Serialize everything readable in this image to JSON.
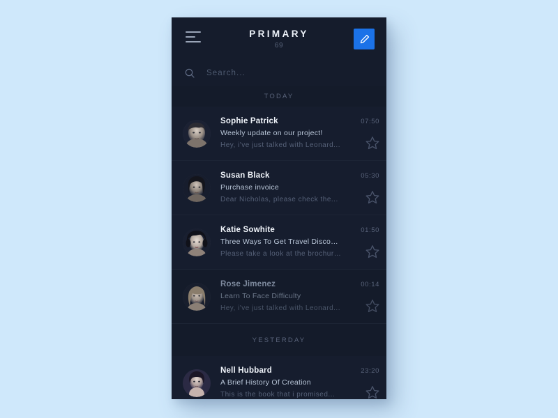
{
  "theme": {
    "page_background": "#cfe8fb",
    "app_background": "#161d2e",
    "header_background": "#151c2c",
    "accent": "#1b72e8",
    "divider": "#1d2536",
    "muted_text": "#59637a"
  },
  "header": {
    "menu_icon": "hamburger-icon",
    "title": "PRIMARY",
    "count": "69",
    "compose_icon": "pencil-icon"
  },
  "search": {
    "icon": "search-icon",
    "value": "",
    "placeholder": "Search..."
  },
  "sections": [
    {
      "label": "TODAY",
      "messages": [
        {
          "sender": "Sophie Patrick",
          "subject": "Weekly update on our project!",
          "preview": "Hey, i've just talked with Leonard...",
          "time": "07:50",
          "read": false,
          "starred": false,
          "star_icon": "star-outline-icon",
          "avatar": "avatar-sophie-patrick"
        },
        {
          "sender": "Susan Black",
          "subject": "Purchase invoice",
          "preview": "Dear Nicholas, please check the...",
          "time": "05:30",
          "read": false,
          "starred": false,
          "star_icon": "star-outline-icon",
          "avatar": "avatar-susan-black"
        },
        {
          "sender": "Katie Sowhite",
          "subject": "Three Ways To Get Travel Discounts",
          "preview": "Please take a look at the brochure...",
          "time": "01:50",
          "read": false,
          "starred": false,
          "star_icon": "star-outline-icon",
          "avatar": "avatar-katie-sowhite"
        },
        {
          "sender": "Rose Jimenez",
          "subject": "Learn To Face Difficulty",
          "preview": "Hey, i've just talked with Leonard...",
          "time": "00:14",
          "read": true,
          "starred": false,
          "star_icon": "star-outline-icon",
          "avatar": "avatar-rose-jimenez"
        }
      ]
    },
    {
      "label": "YESTERDAY",
      "messages": [
        {
          "sender": "Nell Hubbard",
          "subject": "A Brief History Of Creation",
          "preview": "This is the book that i promised...",
          "time": "23:20",
          "read": false,
          "starred": false,
          "star_icon": "star-outline-icon",
          "avatar": "avatar-nell-hubbard"
        }
      ]
    }
  ]
}
